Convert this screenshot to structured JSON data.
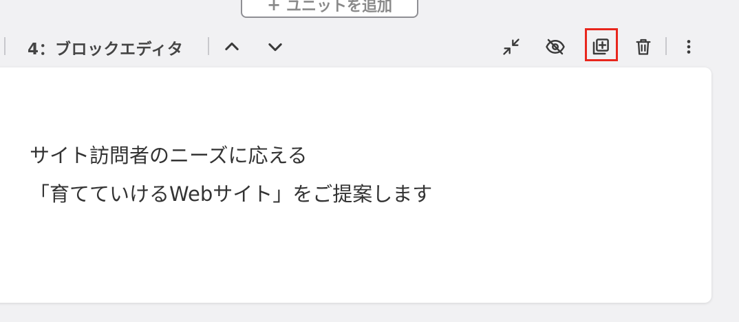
{
  "add_unit_button": {
    "plus": "+",
    "label": "ユニットを追加"
  },
  "toolbar": {
    "unit_title": "4：ブロックエディタ",
    "icons": {
      "move_up": "chevron-up-icon",
      "move_down": "chevron-down-icon",
      "collapse": "collapse-icon",
      "hide": "eye-off-icon",
      "duplicate": "duplicate-icon",
      "delete": "trash-icon",
      "more": "more-vertical-icon"
    }
  },
  "content": {
    "lines": [
      "サイト訪問者のニーズに応える",
      "「育てていけるWebサイト」をご提案します"
    ]
  },
  "colors": {
    "background": "#f1f1f3",
    "icon": "#3a3a3a",
    "highlight": "#e8261c",
    "text": "#333333"
  }
}
